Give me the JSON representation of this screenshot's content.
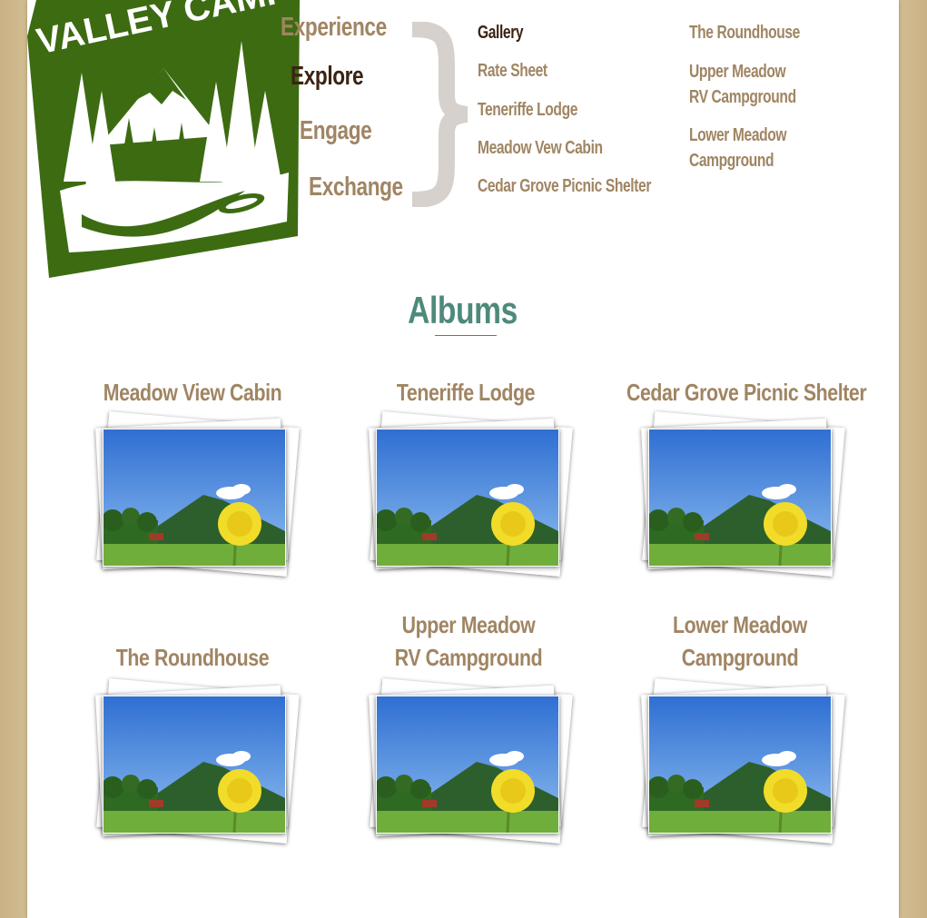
{
  "logo": {
    "text": "VALLEY CAMP"
  },
  "main_nav": [
    {
      "label": "Experience",
      "active": false
    },
    {
      "label": "Explore",
      "active": true
    },
    {
      "label": "Engage",
      "active": false
    },
    {
      "label": "Exchange",
      "active": false
    }
  ],
  "sub_nav": {
    "col1": [
      "Gallery",
      "Rate Sheet",
      "Teneriffe Lodge",
      "Meadow Vew Cabin",
      "Cedar Grove Picnic Shelter"
    ],
    "col2": [
      "The Roundhouse",
      "Upper Meadow\nRV Campground",
      "Lower Meadow\nCampground"
    ],
    "active": "Gallery"
  },
  "page_title": "Albums",
  "albums": [
    {
      "title": "Meadow View Cabin"
    },
    {
      "title": "Teneriffe Lodge"
    },
    {
      "title": "Cedar Grove Picnic Shelter"
    },
    {
      "title": "The Roundhouse"
    },
    {
      "title": "Upper Meadow\nRV Campground"
    },
    {
      "title": "Lower Meadow\nCampground"
    }
  ],
  "colors": {
    "background": "#cdb68a",
    "logo_green": "#3d6b12",
    "nav_text": "#a08563",
    "nav_active": "#3b2313",
    "title_teal": "#4e8a7c"
  }
}
